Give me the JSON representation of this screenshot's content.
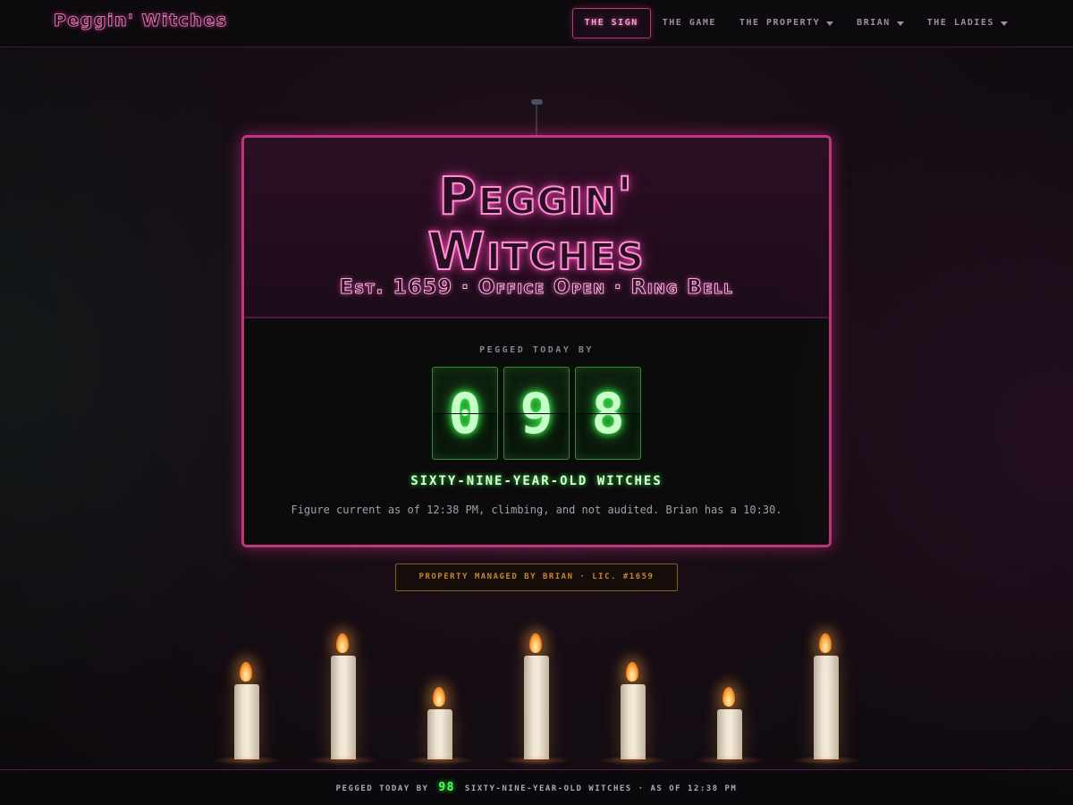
{
  "nav": {
    "brand": "Peggin' Witches",
    "links": [
      {
        "label": "The Sign",
        "active": true,
        "dropdown": false
      },
      {
        "label": "The Game",
        "active": false,
        "dropdown": false
      },
      {
        "label": "The Property",
        "active": false,
        "dropdown": true
      },
      {
        "label": "Brian",
        "active": false,
        "dropdown": true
      },
      {
        "label": "The Ladies",
        "active": false,
        "dropdown": true
      }
    ]
  },
  "sign": {
    "title_line1": "Peggin'",
    "title_line2": "Witches",
    "tagline": "Est. 1659 · Office Open · Ring Bell",
    "counter_label": "Pegged today by",
    "digits": [
      "0",
      "9",
      "8"
    ],
    "unit": "sixty-nine-year-old witches",
    "note": "Figure current as of 12:38 PM, climbing, and not audited. Brian has a 10:30."
  },
  "plaque": "Property managed by Brian · Lic. #1659",
  "footer": {
    "prefix": "Pegged today by",
    "count": "98",
    "suffix": "sixty-nine-year-old witches · as of 12:38 PM"
  },
  "colors": {
    "neon_pink": "#ff8fd6",
    "sign_border": "#c2367f",
    "counter_green": "#4cff5a",
    "plaque_amber": "#c8862e"
  },
  "icons": {
    "dropdown": "chevron-down-icon",
    "candle": "candle-icon"
  }
}
